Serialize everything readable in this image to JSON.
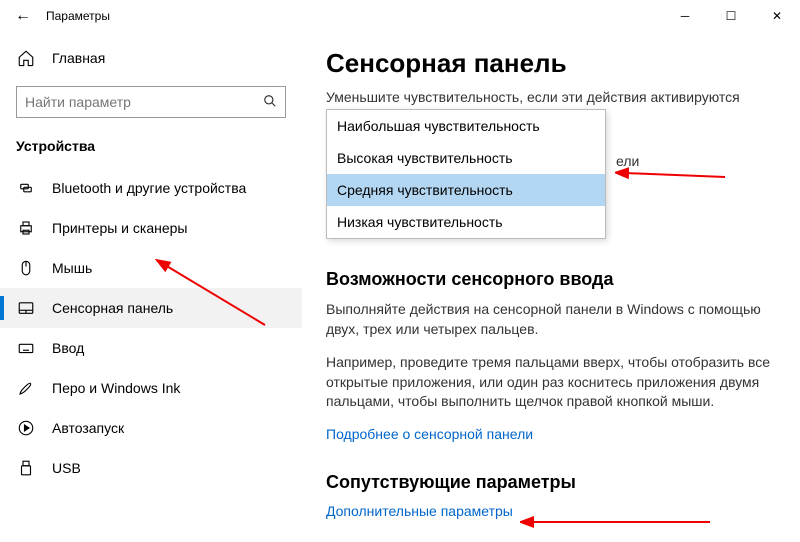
{
  "titlebar": {
    "title": "Параметры"
  },
  "sidebar": {
    "home": "Главная",
    "searchPlaceholder": "Найти параметр",
    "category": "Устройства",
    "items": [
      {
        "label": "Bluetooth и другие устройства"
      },
      {
        "label": "Принтеры и сканеры"
      },
      {
        "label": "Мышь"
      },
      {
        "label": "Сенсорная панель"
      },
      {
        "label": "Ввод"
      },
      {
        "label": "Перо и Windows Ink"
      },
      {
        "label": "Автозапуск"
      },
      {
        "label": "USB"
      }
    ]
  },
  "content": {
    "heading": "Сенсорная панель",
    "sensDesc": "Уменьшите чувствительность, если эти действия активируются",
    "partialText": "ели",
    "dropdown": {
      "options": [
        "Наибольшая чувствительность",
        "Высокая чувствительность",
        "Средняя чувствительность",
        "Низкая чувствительность"
      ]
    },
    "section2": "Возможности сенсорного ввода",
    "para1": "Выполняйте действия на сенсорной панели в Windows с помощью двух, трех или четырех пальцев.",
    "para2": "Например, проведите тремя пальцами вверх, чтобы отобразить все открытые приложения, или один раз коснитесь приложения двумя пальцами, чтобы выполнить щелчок правой кнопкой мыши.",
    "link1": "Подробнее о сенсорной панели",
    "section3": "Сопутствующие параметры",
    "link2": "Дополнительные параметры"
  }
}
